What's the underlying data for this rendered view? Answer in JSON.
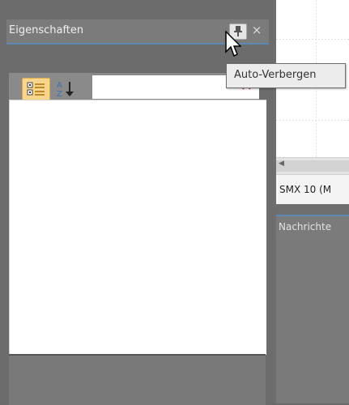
{
  "properties_panel": {
    "title": "Eigenschaften",
    "close_glyph": "×",
    "pin_tooltip": "Auto-Verbergen",
    "toolbar": {
      "categorized_icon": "categorized-view-icon",
      "alphabetical_icon": "sort-alphabetical-icon",
      "search_value": "",
      "clear_icon": "clear-search-icon"
    }
  },
  "document_tab": {
    "label": "SMX 10 (M"
  },
  "messages_panel": {
    "title": "Nachrichte"
  },
  "colors": {
    "active_border": "#5b89b3",
    "panel_bg": "#6c6c6c",
    "highlight_button": "#f7d58d"
  }
}
